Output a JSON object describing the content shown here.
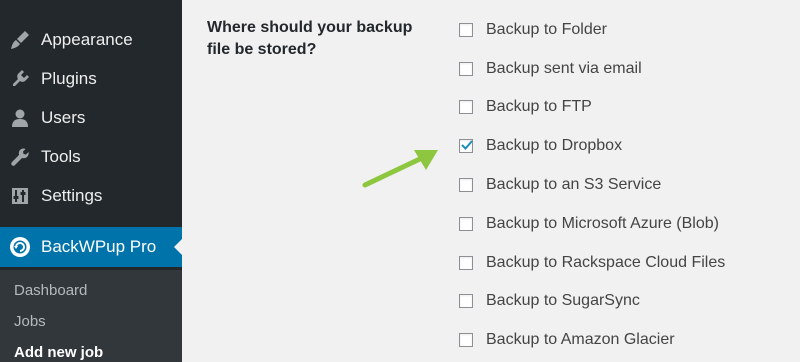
{
  "sidebar": {
    "menu": [
      {
        "label": "Appearance",
        "icon": "paintbrush-icon"
      },
      {
        "label": "Plugins",
        "icon": "plugin-icon"
      },
      {
        "label": "Users",
        "icon": "users-icon"
      },
      {
        "label": "Tools",
        "icon": "wrench-icon"
      },
      {
        "label": "Settings",
        "icon": "settings-icon"
      }
    ],
    "active": {
      "label": "BackWPup Pro",
      "icon": "backwpup-icon"
    },
    "submenu": [
      {
        "label": "Dashboard"
      },
      {
        "label": "Jobs"
      },
      {
        "label": "Add new job",
        "current": true
      }
    ]
  },
  "main": {
    "question": "Where should your backup file be stored?",
    "options": [
      {
        "label": "Backup to Folder",
        "checked": false
      },
      {
        "label": "Backup sent via email",
        "checked": false
      },
      {
        "label": "Backup to FTP",
        "checked": false
      },
      {
        "label": "Backup to Dropbox",
        "checked": true
      },
      {
        "label": "Backup to an S3 Service",
        "checked": false
      },
      {
        "label": "Backup to Microsoft Azure (Blob)",
        "checked": false
      },
      {
        "label": "Backup to Rackspace Cloud Files",
        "checked": false
      },
      {
        "label": "Backup to SugarSync",
        "checked": false
      },
      {
        "label": "Backup to Amazon Glacier",
        "checked": false
      }
    ]
  },
  "annotation": {
    "icon": "green-arrow-icon",
    "color": "#8dc63f"
  },
  "colors": {
    "sidebar_bg": "#23282d",
    "submenu_bg": "#32373c",
    "active_bg": "#0073aa",
    "content_bg": "#f1f1f1",
    "checkmark": "#1e8cbe"
  }
}
